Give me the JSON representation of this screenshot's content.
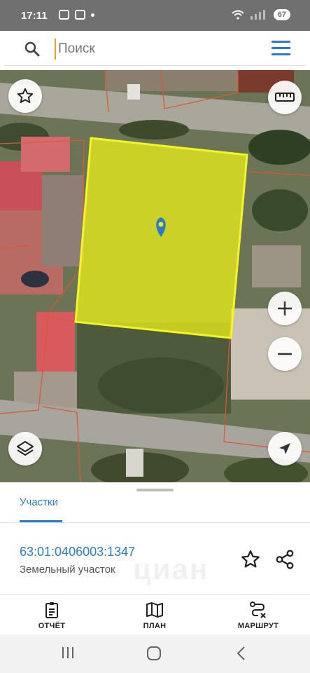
{
  "status_bar": {
    "time": "17:11",
    "battery": "67"
  },
  "search": {
    "placeholder": "Поиск"
  },
  "map": {
    "parcel_fill_color": "#e8ea1a",
    "parcel_border_color": "#f2f527",
    "boundary_color": "#d9573a",
    "marker_color": "#2f7cc4"
  },
  "sheet": {
    "tab_label": "Участки",
    "parcel_number": "63:01:0406003:1347",
    "parcel_type": "Земельный участок",
    "watermark": "циан"
  },
  "bottom_nav": {
    "report_label": "ОТЧЁТ",
    "plan_label": "ПЛАН",
    "route_label": "МАРШРУТ"
  },
  "colors": {
    "accent": "#2f7cc4"
  }
}
